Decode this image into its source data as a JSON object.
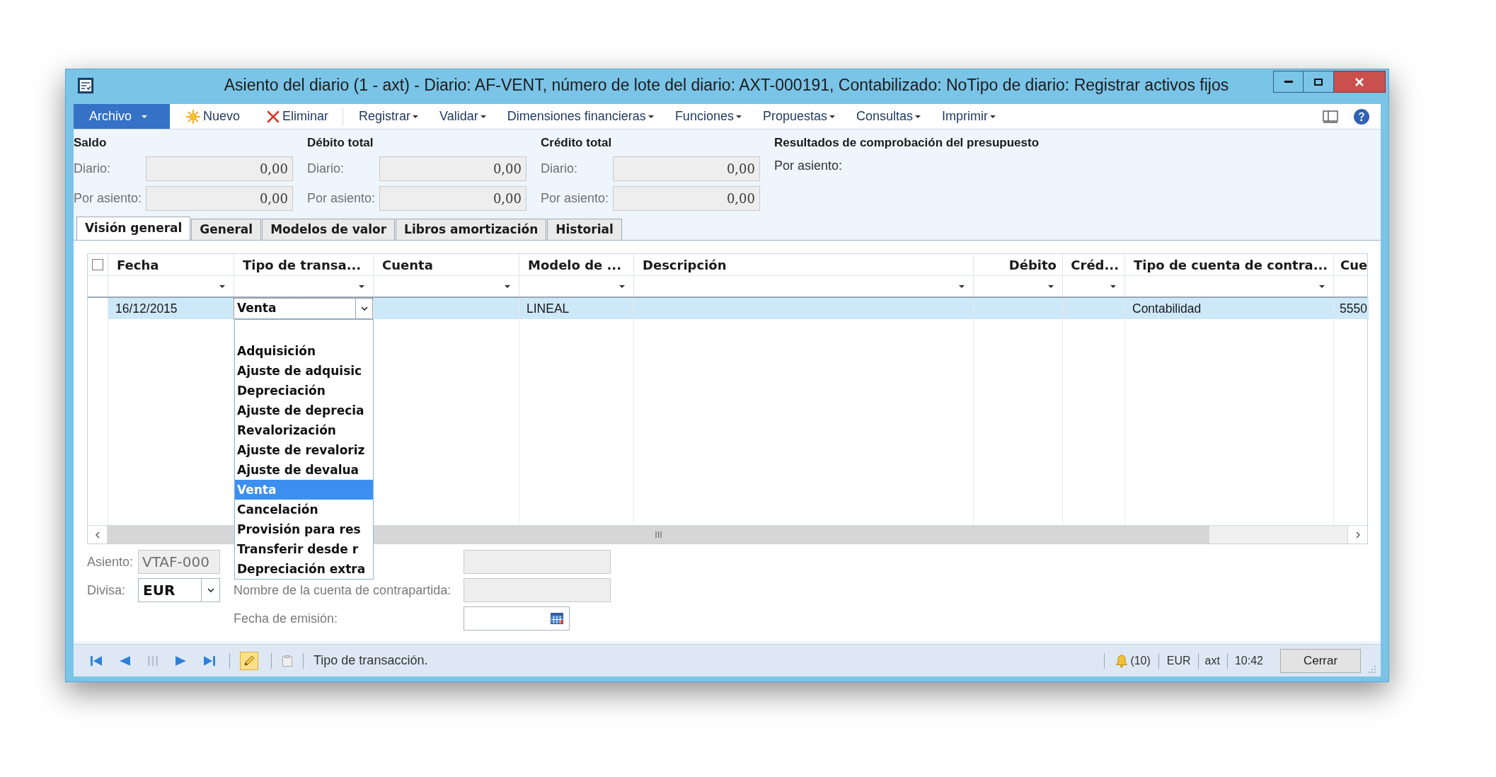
{
  "window": {
    "title": "Asiento del diario (1 - axt) - Diario: AF-VENT, número de lote del diario: AXT-000191, Contabilizado: NoTipo de diario: Registrar activos fijos"
  },
  "toolbar": {
    "file_menu": "Archivo",
    "items": [
      {
        "kind": "new",
        "label": "Nuevo"
      },
      {
        "kind": "delete",
        "label": "Eliminar"
      },
      {
        "kind": "menu",
        "label": "Registrar"
      },
      {
        "kind": "menu",
        "label": "Validar"
      },
      {
        "kind": "menu",
        "label": "Dimensiones financieras"
      },
      {
        "kind": "menu",
        "label": "Funciones"
      },
      {
        "kind": "menu",
        "label": "Propuestas"
      },
      {
        "kind": "menu",
        "label": "Consultas"
      },
      {
        "kind": "menu",
        "label": "Imprimir"
      }
    ]
  },
  "totals": [
    {
      "title": "Saldo",
      "fields": [
        {
          "label": "Diario:",
          "value": "0,00",
          "disabled": true
        },
        {
          "label": "Por asiento:",
          "value": "0,00",
          "disabled": true
        }
      ]
    },
    {
      "title": "Débito total",
      "fields": [
        {
          "label": "Diario:",
          "value": "0,00",
          "disabled": true
        },
        {
          "label": "Por asiento:",
          "value": "0,00",
          "disabled": true
        }
      ]
    },
    {
      "title": "Crédito total",
      "fields": [
        {
          "label": "Diario:",
          "value": "0,00",
          "disabled": true
        },
        {
          "label": "Por asiento:",
          "value": "0,00",
          "disabled": true
        }
      ]
    }
  ],
  "budget_check": {
    "title": "Resultados de comprobación del presupuesto",
    "label": "Por asiento:"
  },
  "tabs": [
    {
      "label": "Visión general",
      "selected": true
    },
    {
      "label": "General",
      "selected": false
    },
    {
      "label": "Modelos de valor",
      "selected": false
    },
    {
      "label": "Libros amortización",
      "selected": false
    },
    {
      "label": "Historial",
      "selected": false
    }
  ],
  "grid": {
    "select_all": {
      "checked": false
    },
    "columns": [
      {
        "label": "Fecha",
        "kind": "text"
      },
      {
        "label": "Tipo de transa...",
        "kind": "text"
      },
      {
        "label": "Cuenta",
        "kind": "text"
      },
      {
        "label": "Modelo de ...",
        "kind": "text"
      },
      {
        "label": "Descripción",
        "kind": "text"
      },
      {
        "label": "Débito",
        "kind": "amount"
      },
      {
        "label": "Créd...",
        "kind": "amount"
      },
      {
        "label": "Tipo de cuenta de contra...",
        "kind": "text"
      },
      {
        "label": "Cue",
        "kind": "text"
      }
    ],
    "rows": [
      {
        "selected": true,
        "cells": [
          "16/12/2015",
          {
            "value": "Venta",
            "options": [
              {
                "label": "Adquisición",
                "selected": false
              },
              {
                "label": "Ajuste de adquisic",
                "selected": false
              },
              {
                "label": "Depreciación",
                "selected": false
              },
              {
                "label": "Ajuste de deprecia",
                "selected": false
              },
              {
                "label": "Revalorización",
                "selected": false
              },
              {
                "label": "Ajuste de revaloriz",
                "selected": false
              },
              {
                "label": "Ajuste de devalua",
                "selected": false
              },
              {
                "label": "Venta",
                "selected": true
              },
              {
                "label": "Cancelación",
                "selected": false
              },
              {
                "label": "Provisión para res",
                "selected": false
              },
              {
                "label": "Transferir desde r",
                "selected": false
              },
              {
                "label": "Depreciación extra",
                "selected": false
              }
            ]
          },
          null,
          "LINEAL",
          null,
          null,
          null,
          "Contabilidad",
          "5550"
        ]
      }
    ]
  },
  "details": [
    {
      "label": "Asiento:",
      "kind": "text",
      "value": "VTAF-000",
      "disabled": true
    },
    {
      "label": "Divisa:",
      "kind": "combo",
      "value": "EUR",
      "disabled": false
    }
  ],
  "offset_fields": [
    {
      "kind": "text",
      "disabled": true
    },
    {
      "label": "Nombre de la cuenta de contrapartida:",
      "kind": "text",
      "disabled": true
    },
    {
      "label": "Fecha de emisión:",
      "kind": "date",
      "disabled": false
    }
  ],
  "status_bar": {
    "edit_mode": true,
    "message": "Tipo de transacción.",
    "notifications": "(10)",
    "currency": "EUR",
    "company": "axt",
    "time": "10:42",
    "close_button": "Cerrar"
  }
}
